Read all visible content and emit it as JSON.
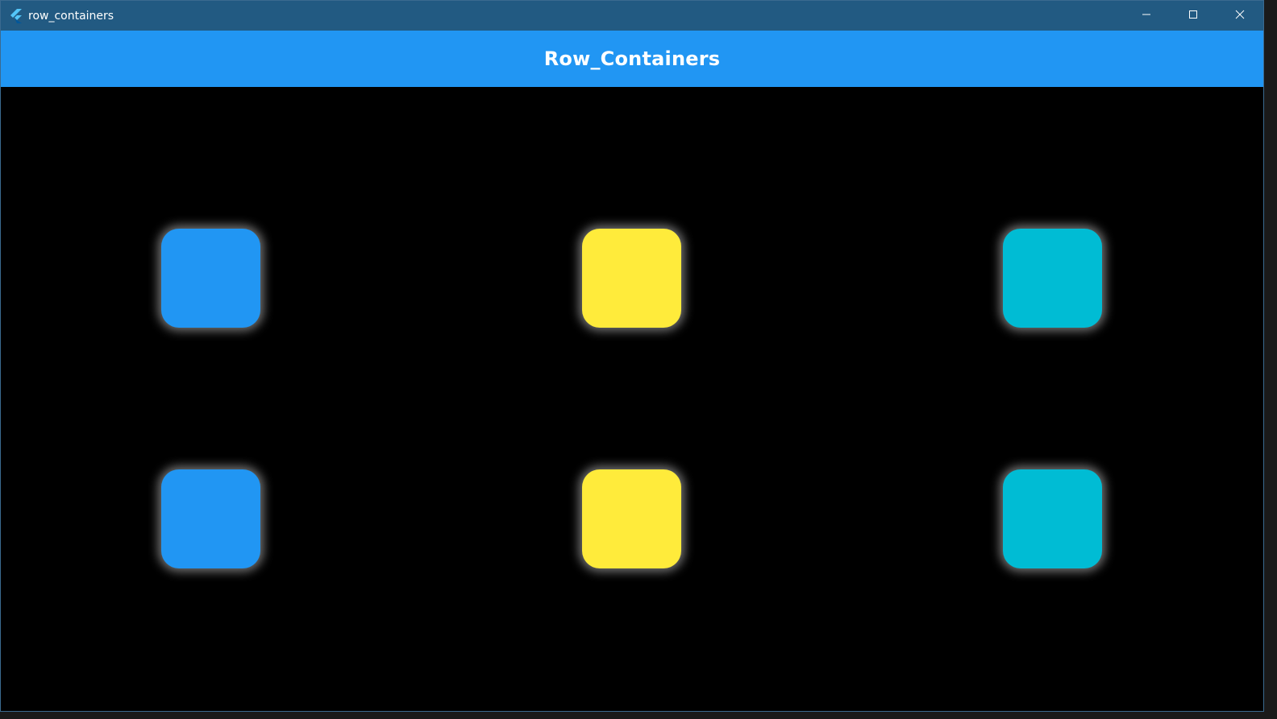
{
  "window": {
    "title": "row_containers",
    "icon": "flutter-icon",
    "controls": [
      "minimize-icon",
      "maximize-icon",
      "close-icon"
    ]
  },
  "appbar": {
    "title": "Row_Containers",
    "color": "#2196f3"
  },
  "colors": {
    "titlebar": "#225a82",
    "background": "#000000",
    "blue": "#2196f3",
    "yellow": "#ffeb3b",
    "cyan": "#00bcd4"
  },
  "rows": [
    {
      "boxes": [
        {
          "color": "#2196f3"
        },
        {
          "color": "#ffeb3b"
        },
        {
          "color": "#00bcd4"
        }
      ]
    },
    {
      "boxes": [
        {
          "color": "#2196f3"
        },
        {
          "color": "#ffeb3b"
        },
        {
          "color": "#00bcd4"
        }
      ]
    }
  ]
}
